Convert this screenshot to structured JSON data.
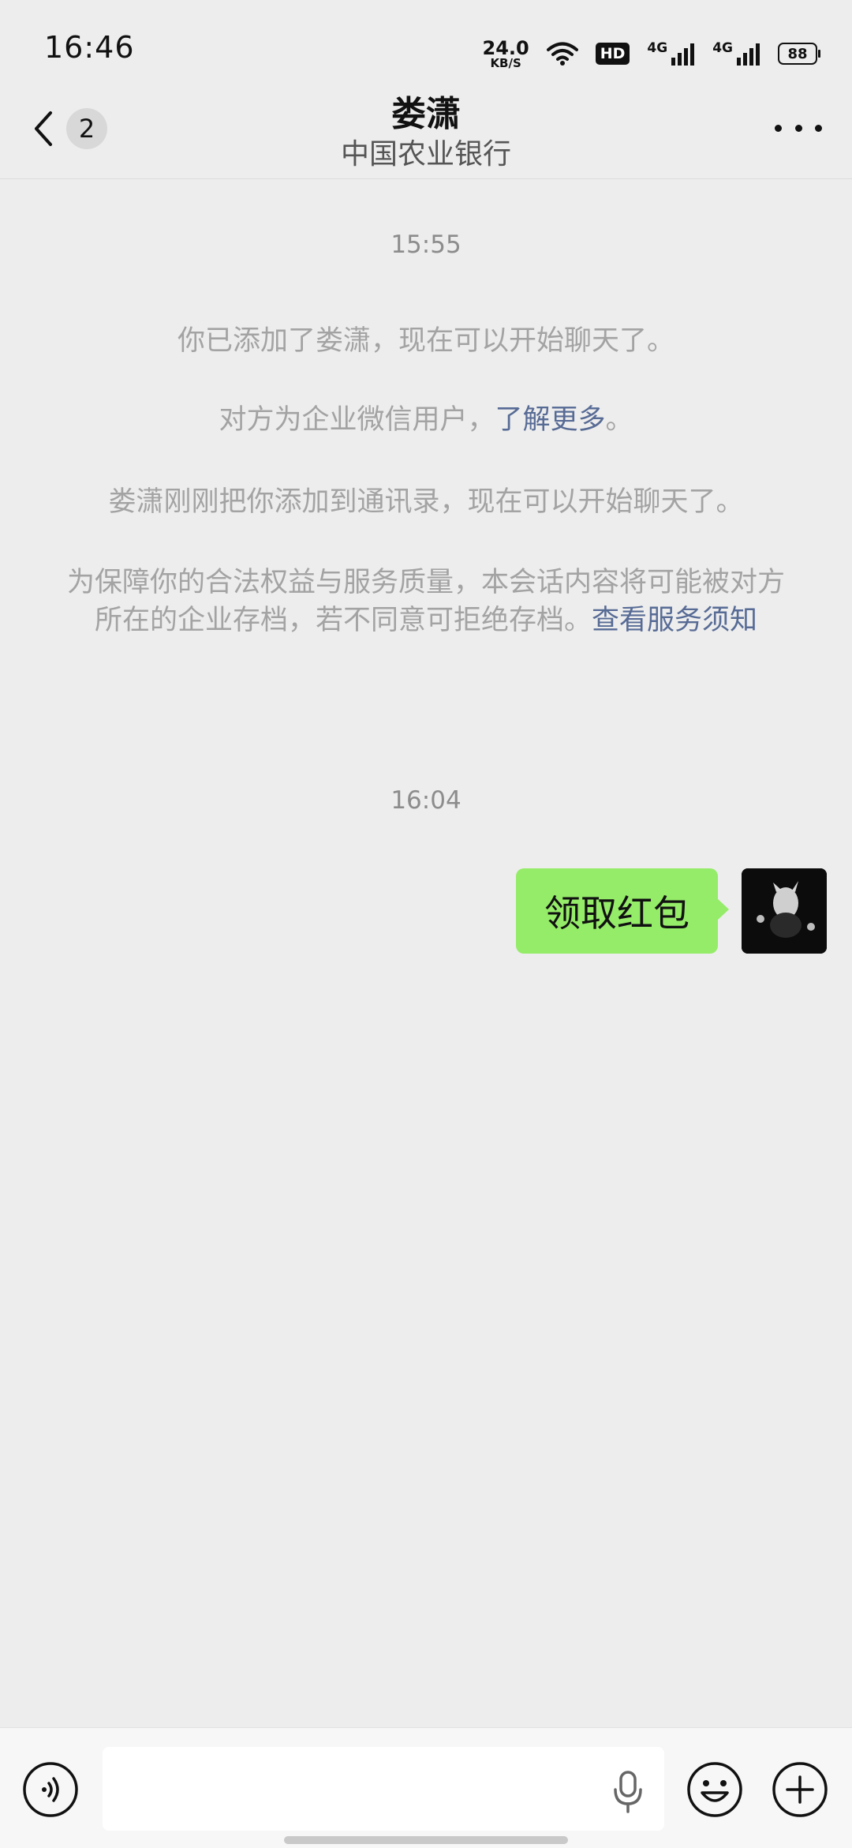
{
  "status_bar": {
    "time": "16:46",
    "net_speed_value": "24.0",
    "net_speed_unit": "KB/S",
    "hd_label": "HD",
    "signal1_label": "4G",
    "signal2_label": "4G",
    "battery": "88"
  },
  "header": {
    "back_badge": "2",
    "title": "娄潇",
    "subtitle": "中国农业银行"
  },
  "chat": {
    "time1": "15:55",
    "sys_msg1": "你已添加了娄潇，现在可以开始聊天了。",
    "sys_msg2_text": "对方为企业微信用户，",
    "sys_msg2_link": "了解更多",
    "sys_msg2_end": "。",
    "sys_msg3": "娄潇刚刚把你添加到通讯录，现在可以开始聊天了。",
    "sys_msg4_text": "为保障你的合法权益与服务质量，本会话内容将可能被对方所在的企业存档，若不同意可拒绝存档。",
    "sys_msg4_link": "查看服务须知",
    "time2": "16:04",
    "message1": "领取红包"
  },
  "input_bar": {
    "text_value": ""
  },
  "colors": {
    "background": "#ededed",
    "bubble_green": "#95ec69",
    "link_blue": "#576b95"
  },
  "icons": [
    "back-chevron-icon",
    "more-dots-icon",
    "voice-icon",
    "mic-icon",
    "emoji-icon",
    "plus-icon"
  ]
}
